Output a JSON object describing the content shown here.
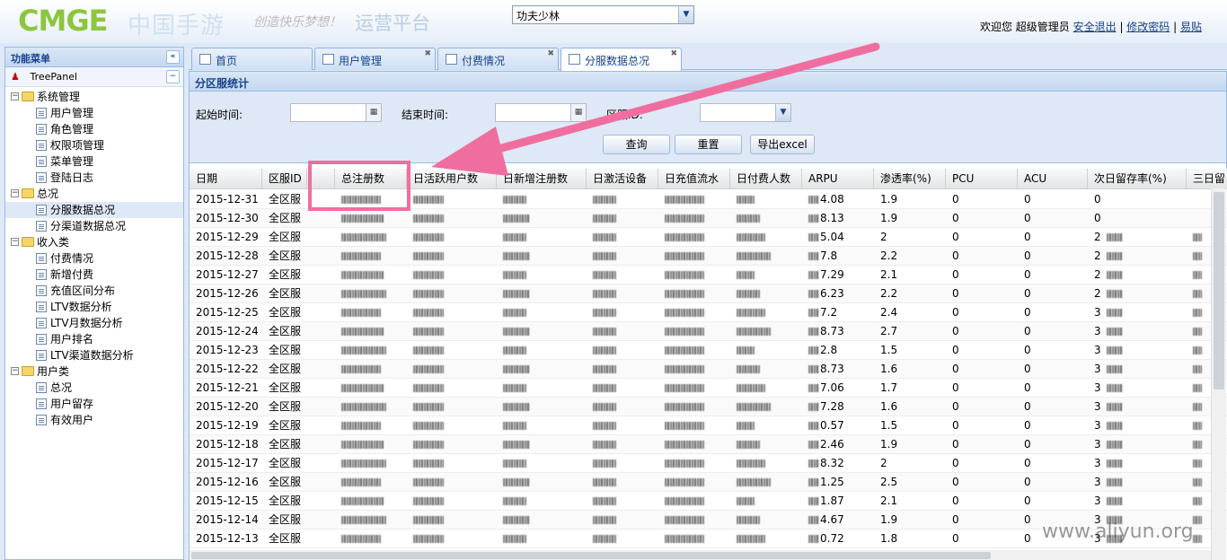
{
  "header": {
    "logo_text": "CMGE",
    "logo_cn": "中国手游",
    "slogan": "创造快乐梦想！",
    "platform": "运营平台",
    "game_select": "功夫少林",
    "welcome": "欢迎您 超级管理员",
    "logout": "安全退出",
    "change_password": "修改密码",
    "easy_post": "易贴"
  },
  "sidebar": {
    "title": "功能菜单",
    "treepanel": "TreePanel",
    "nodes": [
      {
        "label": "系统管理",
        "type": "folder",
        "level": 0
      },
      {
        "label": "用户管理",
        "type": "leaf",
        "level": 1
      },
      {
        "label": "角色管理",
        "type": "leaf",
        "level": 1
      },
      {
        "label": "权限项管理",
        "type": "leaf",
        "level": 1
      },
      {
        "label": "菜单管理",
        "type": "leaf",
        "level": 1
      },
      {
        "label": "登陆日志",
        "type": "leaf",
        "level": 1
      },
      {
        "label": "总况",
        "type": "folder",
        "level": 0
      },
      {
        "label": "分服数据总况",
        "type": "leaf",
        "level": 1,
        "selected": true
      },
      {
        "label": "分渠道数据总况",
        "type": "leaf",
        "level": 1
      },
      {
        "label": "收入类",
        "type": "folder",
        "level": 0
      },
      {
        "label": "付费情况",
        "type": "leaf",
        "level": 1
      },
      {
        "label": "新增付费",
        "type": "leaf",
        "level": 1
      },
      {
        "label": "充值区间分布",
        "type": "leaf",
        "level": 1
      },
      {
        "label": "LTV数据分析",
        "type": "leaf",
        "level": 1
      },
      {
        "label": "LTV月数据分析",
        "type": "leaf",
        "level": 1
      },
      {
        "label": "用户排名",
        "type": "leaf",
        "level": 1
      },
      {
        "label": "LTV渠道数据分析",
        "type": "leaf",
        "level": 1
      },
      {
        "label": "用户类",
        "type": "folder",
        "level": 0
      },
      {
        "label": "总况",
        "type": "leaf",
        "level": 1
      },
      {
        "label": "用户留存",
        "type": "leaf",
        "level": 1
      },
      {
        "label": "有效用户",
        "type": "leaf",
        "level": 1
      }
    ]
  },
  "tabs": [
    {
      "label": "首页",
      "closable": false
    },
    {
      "label": "用户管理",
      "closable": true
    },
    {
      "label": "付费情况",
      "closable": true
    },
    {
      "label": "分服数据总况",
      "closable": true,
      "active": true
    }
  ],
  "panel": {
    "title": "分区服统计",
    "start_label": "起始时间:",
    "end_label": "结束时间:",
    "server_label": "区服ID:",
    "start_value": "",
    "end_value": "",
    "server_value": "",
    "query_button": "查询",
    "reset_button": "重置",
    "export_button": "导出excel"
  },
  "grid": {
    "columns": [
      "日期",
      "区服ID",
      "",
      "总注册数",
      "日活跃用户数",
      "日新增注册数",
      "日激活设备",
      "日充值流水",
      "日付费人数",
      "ARPU",
      "渗透率(%)",
      "PCU",
      "ACU",
      "次日留存率(%)",
      "三日留"
    ],
    "rows": [
      {
        "date": "2015-12-31",
        "server": "全区服",
        "arpu": "4.08",
        "rate": "1.9",
        "pcu": "0",
        "acu": "0",
        "d1": "0"
      },
      {
        "date": "2015-12-30",
        "server": "全区服",
        "arpu": "8.13",
        "rate": "1.9",
        "pcu": "0",
        "acu": "0",
        "d1": "0"
      },
      {
        "date": "2015-12-29",
        "server": "全区服",
        "arpu": "5.04",
        "rate": "2",
        "pcu": "0",
        "acu": "0",
        "d1": "2"
      },
      {
        "date": "2015-12-28",
        "server": "全区服",
        "arpu": "7.8",
        "rate": "2.2",
        "pcu": "0",
        "acu": "0",
        "d1": "2"
      },
      {
        "date": "2015-12-27",
        "server": "全区服",
        "arpu": "7.29",
        "rate": "2.1",
        "pcu": "0",
        "acu": "0",
        "d1": "2"
      },
      {
        "date": "2015-12-26",
        "server": "全区服",
        "arpu": "6.23",
        "rate": "2.2",
        "pcu": "0",
        "acu": "0",
        "d1": "2"
      },
      {
        "date": "2015-12-25",
        "server": "全区服",
        "arpu": "7.2",
        "rate": "2.4",
        "pcu": "0",
        "acu": "0",
        "d1": "3"
      },
      {
        "date": "2015-12-24",
        "server": "全区服",
        "arpu": "8.73",
        "rate": "2.7",
        "pcu": "0",
        "acu": "0",
        "d1": "3"
      },
      {
        "date": "2015-12-23",
        "server": "全区服",
        "arpu": "2.8",
        "rate": "1.5",
        "pcu": "0",
        "acu": "0",
        "d1": "3"
      },
      {
        "date": "2015-12-22",
        "server": "全区服",
        "arpu": "8.73",
        "rate": "1.6",
        "pcu": "0",
        "acu": "0",
        "d1": "3"
      },
      {
        "date": "2015-12-21",
        "server": "全区服",
        "arpu": "7.06",
        "rate": "1.7",
        "pcu": "0",
        "acu": "0",
        "d1": "3"
      },
      {
        "date": "2015-12-20",
        "server": "全区服",
        "arpu": "7.28",
        "rate": "1.6",
        "pcu": "0",
        "acu": "0",
        "d1": "3"
      },
      {
        "date": "2015-12-19",
        "server": "全区服",
        "arpu": "0.57",
        "rate": "1.5",
        "pcu": "0",
        "acu": "0",
        "d1": "3"
      },
      {
        "date": "2015-12-18",
        "server": "全区服",
        "arpu": "2.46",
        "rate": "1.9",
        "pcu": "0",
        "acu": "0",
        "d1": "3"
      },
      {
        "date": "2015-12-17",
        "server": "全区服",
        "arpu": "8.32",
        "rate": "2",
        "pcu": "0",
        "acu": "0",
        "d1": "3"
      },
      {
        "date": "2015-12-16",
        "server": "全区服",
        "arpu": "1.25",
        "rate": "2.5",
        "pcu": "0",
        "acu": "0",
        "d1": "3"
      },
      {
        "date": "2015-12-15",
        "server": "全区服",
        "arpu": "1.87",
        "rate": "2.1",
        "pcu": "0",
        "acu": "0",
        "d1": "3"
      },
      {
        "date": "2015-12-14",
        "server": "全区服",
        "arpu": "4.67",
        "rate": "1.9",
        "pcu": "0",
        "acu": "0",
        "d1": "3"
      },
      {
        "date": "2015-12-13",
        "server": "全区服",
        "arpu": "0.72",
        "rate": "1.8",
        "pcu": "0",
        "acu": "0",
        "d1": "3"
      }
    ]
  },
  "watermark": "www.aliyun.org",
  "colors": {
    "highlight": "#f06e9f",
    "header_blue": "#15428b"
  }
}
